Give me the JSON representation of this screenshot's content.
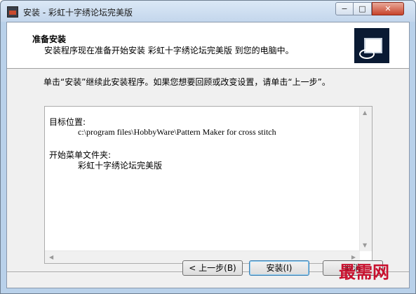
{
  "window": {
    "title": "安装 - 彩虹十字绣论坛完美版",
    "controls": {
      "minimize": "−",
      "maximize": "□",
      "close": "✕"
    }
  },
  "header": {
    "title": "准备安装",
    "description": "安装程序现在准备开始安装 彩虹十字绣论坛完美版 到您的电脑中。"
  },
  "intro": "单击“安装”继续此安装程序。如果您想要回顾或改变设置，请单击“上一步”。",
  "memo": {
    "dest_label": "目标位置:",
    "dest_path": "c:\\program files\\HobbyWare\\Pattern Maker for cross stitch",
    "menu_label": "开始菜单文件夹:",
    "menu_folder": "彩虹十字绣论坛完美版"
  },
  "buttons": {
    "back": "< 上一步(B)",
    "install": "安装(I)",
    "cancel": "取消"
  },
  "watermark": "最需网"
}
